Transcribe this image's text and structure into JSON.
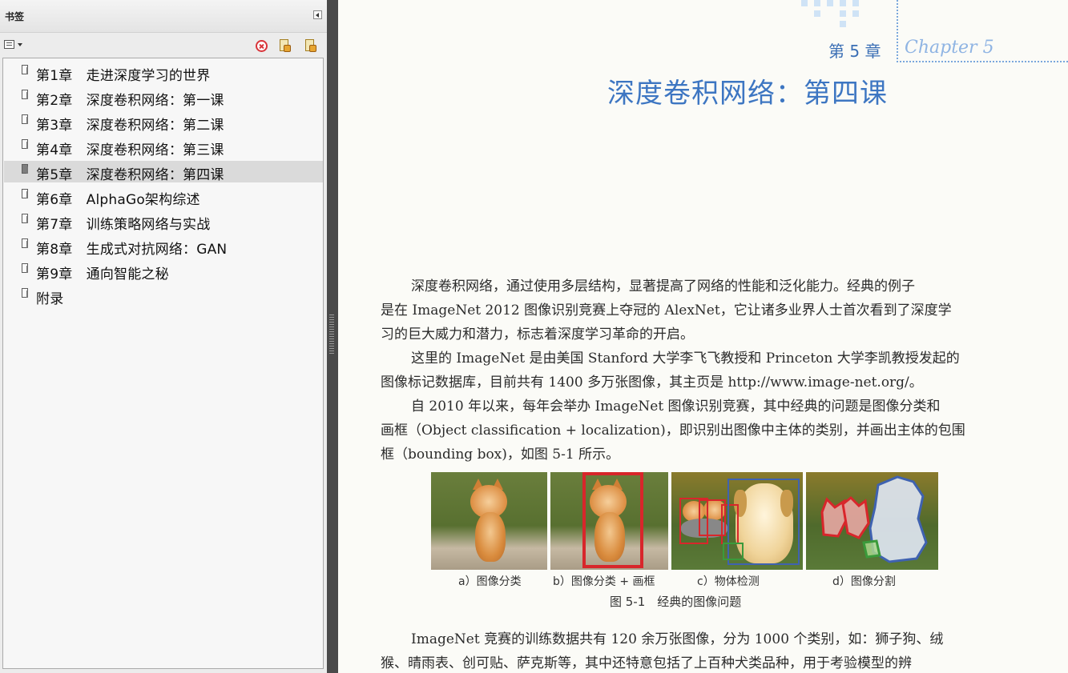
{
  "panel": {
    "title": "书签",
    "bookmarks": [
      {
        "label": "第1章　走进深度学习的世界",
        "selected": false
      },
      {
        "label": "第2章　深度卷积网络：第一课",
        "selected": false
      },
      {
        "label": "第3章　深度卷积网络：第二课",
        "selected": false
      },
      {
        "label": "第4章　深度卷积网络：第三课",
        "selected": false
      },
      {
        "label": "第5章　深度卷积网络：第四课",
        "selected": true
      },
      {
        "label": "第6章　AlphaGo架构综述",
        "selected": false
      },
      {
        "label": "第7章　训练策略网络与实战",
        "selected": false
      },
      {
        "label": "第8章　生成式对抗网络：GAN",
        "selected": false
      },
      {
        "label": "第9章　通向智能之秘",
        "selected": false
      },
      {
        "label": "附录",
        "selected": false
      }
    ],
    "toolbar_icons": [
      "options-menu-icon",
      "delete-icon",
      "expand-bookmark-icon",
      "new-bookmark-icon"
    ]
  },
  "page": {
    "chapter_number": "第 5 章",
    "chapter_english": "Chapter 5",
    "chapter_title": "深度卷积网络：第四课",
    "paragraphs": [
      [
        "深度卷积网络，通过使用多层结构，显著提高了网络的性能和泛化能力。经典的例子",
        "是在 ImageNet 2012 图像识别竞赛上夺冠的 AlexNet，它让诸多业界人士首次看到了深度学",
        "习的巨大威力和潜力，标志着深度学习革命的开启。"
      ],
      [
        "这里的 ImageNet 是由美国 Stanford 大学李飞飞教授和 Princeton 大学李凯教授发起的",
        "图像标记数据库，目前共有 1400 多万张图像，其主页是 http://www.image-net.org/。"
      ],
      [
        "自 2010 年以来，每年会举办 ImageNet 图像识别竞赛，其中经典的问题是图像分类和",
        "画框（Object classification + localization)，即识别出图像中主体的类别，并画出主体的包围",
        "框（bounding box)，如图 5-1 所示。"
      ],
      [
        "ImageNet 竞赛的训练数据共有 120 余万张图像，分为 1000 个类别，如：狮子狗、绒",
        "猴、晴雨表、创可贴、萨克斯等，其中还特意包括了上百种犬类品种，用于考验模型的辨"
      ]
    ],
    "figure": {
      "captions": [
        "a）图像分类",
        "b）图像分类 + 画框",
        "c）物体检测",
        "d）图像分割"
      ],
      "title": "图 5-1　经典的图像问题"
    },
    "colors": {
      "chapter_blue": "#3d76c2",
      "bbox_red": "#d8262b",
      "bbox_blue": "#3f62b0",
      "bbox_green": "#3b9a3b"
    }
  }
}
